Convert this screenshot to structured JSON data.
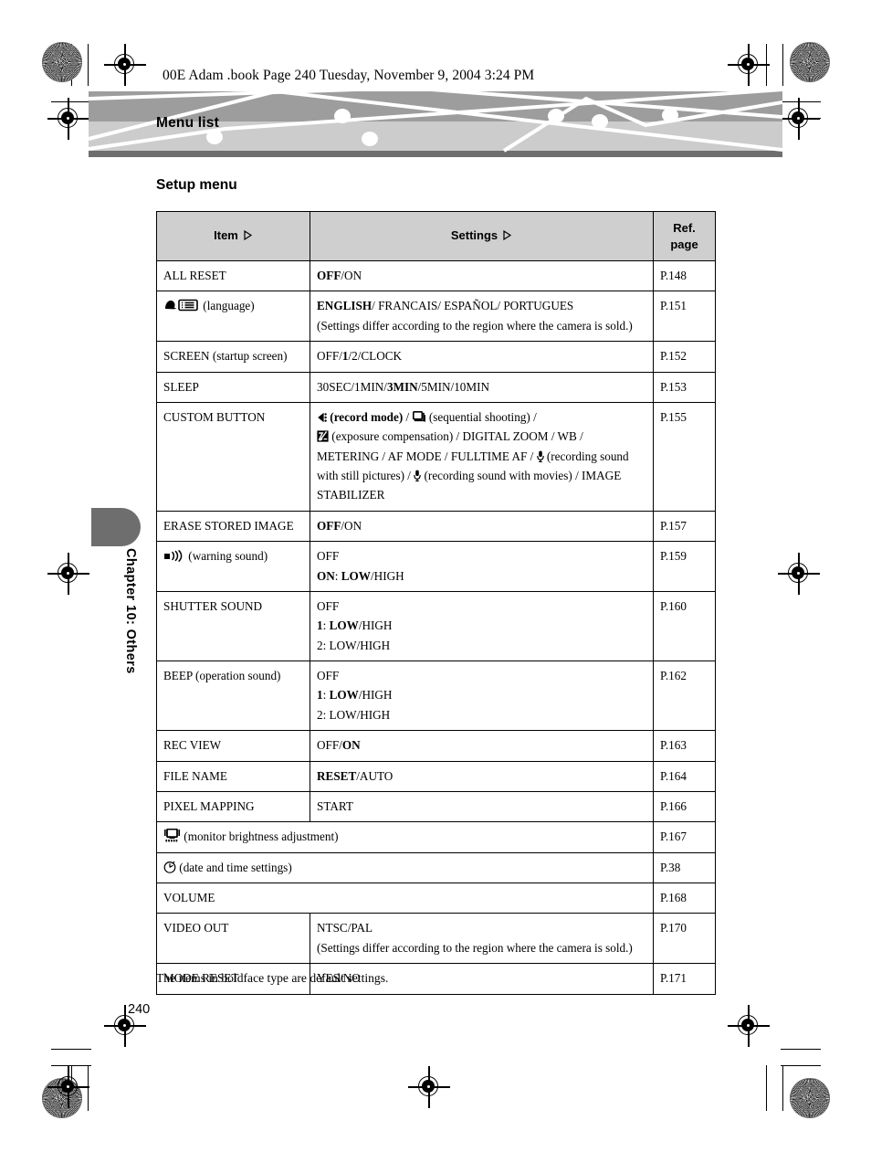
{
  "page": {
    "running_head": "00E Adam .book  Page 240  Tuesday, November 9, 2004  3:24 PM",
    "banner_title": "Menu list",
    "chapter_tab_label": "Chapter 10: Others",
    "section_title": "Setup menu",
    "footnote": "The items in boldface type are default settings.",
    "folio": "240"
  },
  "table": {
    "headers": {
      "item": "Item",
      "settings": "Settings",
      "ref_line1": "Ref.",
      "ref_line2": "page"
    },
    "rows": [
      {
        "item": "ALL RESET",
        "item_icon": null,
        "settings_html": "<span class=\"b\">OFF</span>/ON",
        "ref": "P.148"
      },
      {
        "item": "(language)",
        "item_icon": "language-icon",
        "settings_html": "<span class=\"b\">ENGLISH</span>/ FRANCAIS/ ESPA&Ntilde;OL/ PORTUGUES<br>(Settings differ according to the region where the camera is sold.)",
        "ref": "P.151"
      },
      {
        "item": "SCREEN (startup screen)",
        "item_icon": null,
        "settings_html": "OFF/<span class=\"b\">1</span>/2/CLOCK",
        "ref": "P.152"
      },
      {
        "item": "SLEEP",
        "item_icon": null,
        "settings_html": "30SEC/1MIN/<span class=\"b\">3MIN</span>/5MIN/10MIN",
        "ref": "P.153"
      },
      {
        "item": "CUSTOM BUTTON",
        "item_icon": null,
        "settings_html": "ICON_BURST <span class=\"b\">(record mode)</span> / ICON_SEQ (sequential shooting) /<br>ICON_EXPO (exposure compensation) / DIGITAL ZOOM / WB /<br>METERING / AF MODE / FULLTIME AF / ICON_MIC (recording sound with still pictures) / ICON_MIC (recording sound with movies) / IMAGE STABILIZER",
        "ref": "P.155"
      },
      {
        "item": "ERASE STORED IMAGE",
        "item_icon": null,
        "settings_html": "<span class=\"b\">OFF</span>/ON",
        "ref": "P.157"
      },
      {
        "item": "(warning sound)",
        "item_icon": "warning-sound-icon",
        "settings_html": "OFF<br><span class=\"b\">ON</span>: <span class=\"b\">LOW</span>/HIGH",
        "ref": "P.159"
      },
      {
        "item": "SHUTTER SOUND",
        "item_icon": null,
        "settings_html": "OFF<br><span class=\"b\">1</span>: <span class=\"b\">LOW</span>/HIGH<br>2: LOW/HIGH",
        "ref": "P.160"
      },
      {
        "item": "BEEP (operation sound)",
        "item_icon": null,
        "settings_html": "OFF<br><span class=\"b\">1</span>: <span class=\"b\">LOW</span>/HIGH<br>2: LOW/HIGH",
        "ref": "P.162"
      },
      {
        "item": "REC VIEW",
        "item_icon": null,
        "settings_html": "OFF/<span class=\"b\">ON</span>",
        "ref": "P.163"
      },
      {
        "item": "FILE NAME",
        "item_icon": null,
        "settings_html": "<span class=\"b\">RESET</span>/AUTO",
        "ref": "P.164"
      },
      {
        "item": "PIXEL MAPPING",
        "item_icon": null,
        "settings_html": "START",
        "ref": "P.166"
      },
      {
        "item": "(monitor brightness adjustment)",
        "item_icon": "monitor-brightness-icon",
        "settings_html": null,
        "span": true,
        "ref": "P.167"
      },
      {
        "item": "(date and time settings)",
        "item_icon": "clock-icon",
        "settings_html": null,
        "span": true,
        "ref": "P.38"
      },
      {
        "item": "VOLUME",
        "item_icon": null,
        "settings_html": null,
        "span": true,
        "ref": "P.168"
      },
      {
        "item": "VIDEO OUT",
        "item_icon": null,
        "settings_html": "NTSC/PAL<br>(Settings differ according to the region where the camera is sold.)",
        "ref": "P.170"
      },
      {
        "item": "MODE RESET",
        "item_icon": null,
        "settings_html": "YES/NO",
        "ref": "P.171"
      }
    ]
  },
  "colors": {
    "banner_dark": "#9d9d9d",
    "banner_light": "#cccccc",
    "banner_rule": "#6e6e6e",
    "table_header_bg": "#cfcfcf",
    "chapter_tab": "#6e6e6e"
  }
}
